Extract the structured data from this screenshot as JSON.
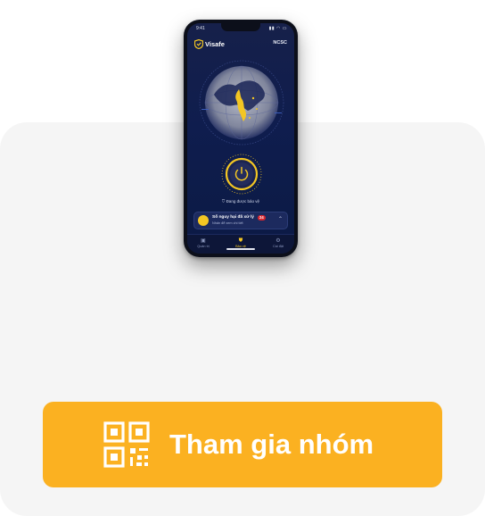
{
  "phone": {
    "status": {
      "time": "9:41",
      "icons": "▮▮ ◠ ▭"
    },
    "app": {
      "name": "Visafe",
      "partner": "NCSC"
    },
    "protection_text": "Đang được bảo vệ",
    "threat_card": {
      "title": "Số nguy hại đã xử lý",
      "count": "24",
      "subtitle": "Nhấn để xem chi tiết"
    },
    "tabs": [
      {
        "label": "Quản trị",
        "icon": "admin-icon"
      },
      {
        "label": "Bảo vệ",
        "icon": "shield-icon"
      },
      {
        "label": "Cài đặt",
        "icon": "settings-icon"
      }
    ]
  },
  "join_button": {
    "label": "Tham gia nhóm",
    "icon": "qr-code-icon"
  },
  "colors": {
    "accent": "#fbb121",
    "screen_bg": "#0f1d4e",
    "power_glow": "#f3c623",
    "threat_badge": "#d8262e"
  }
}
